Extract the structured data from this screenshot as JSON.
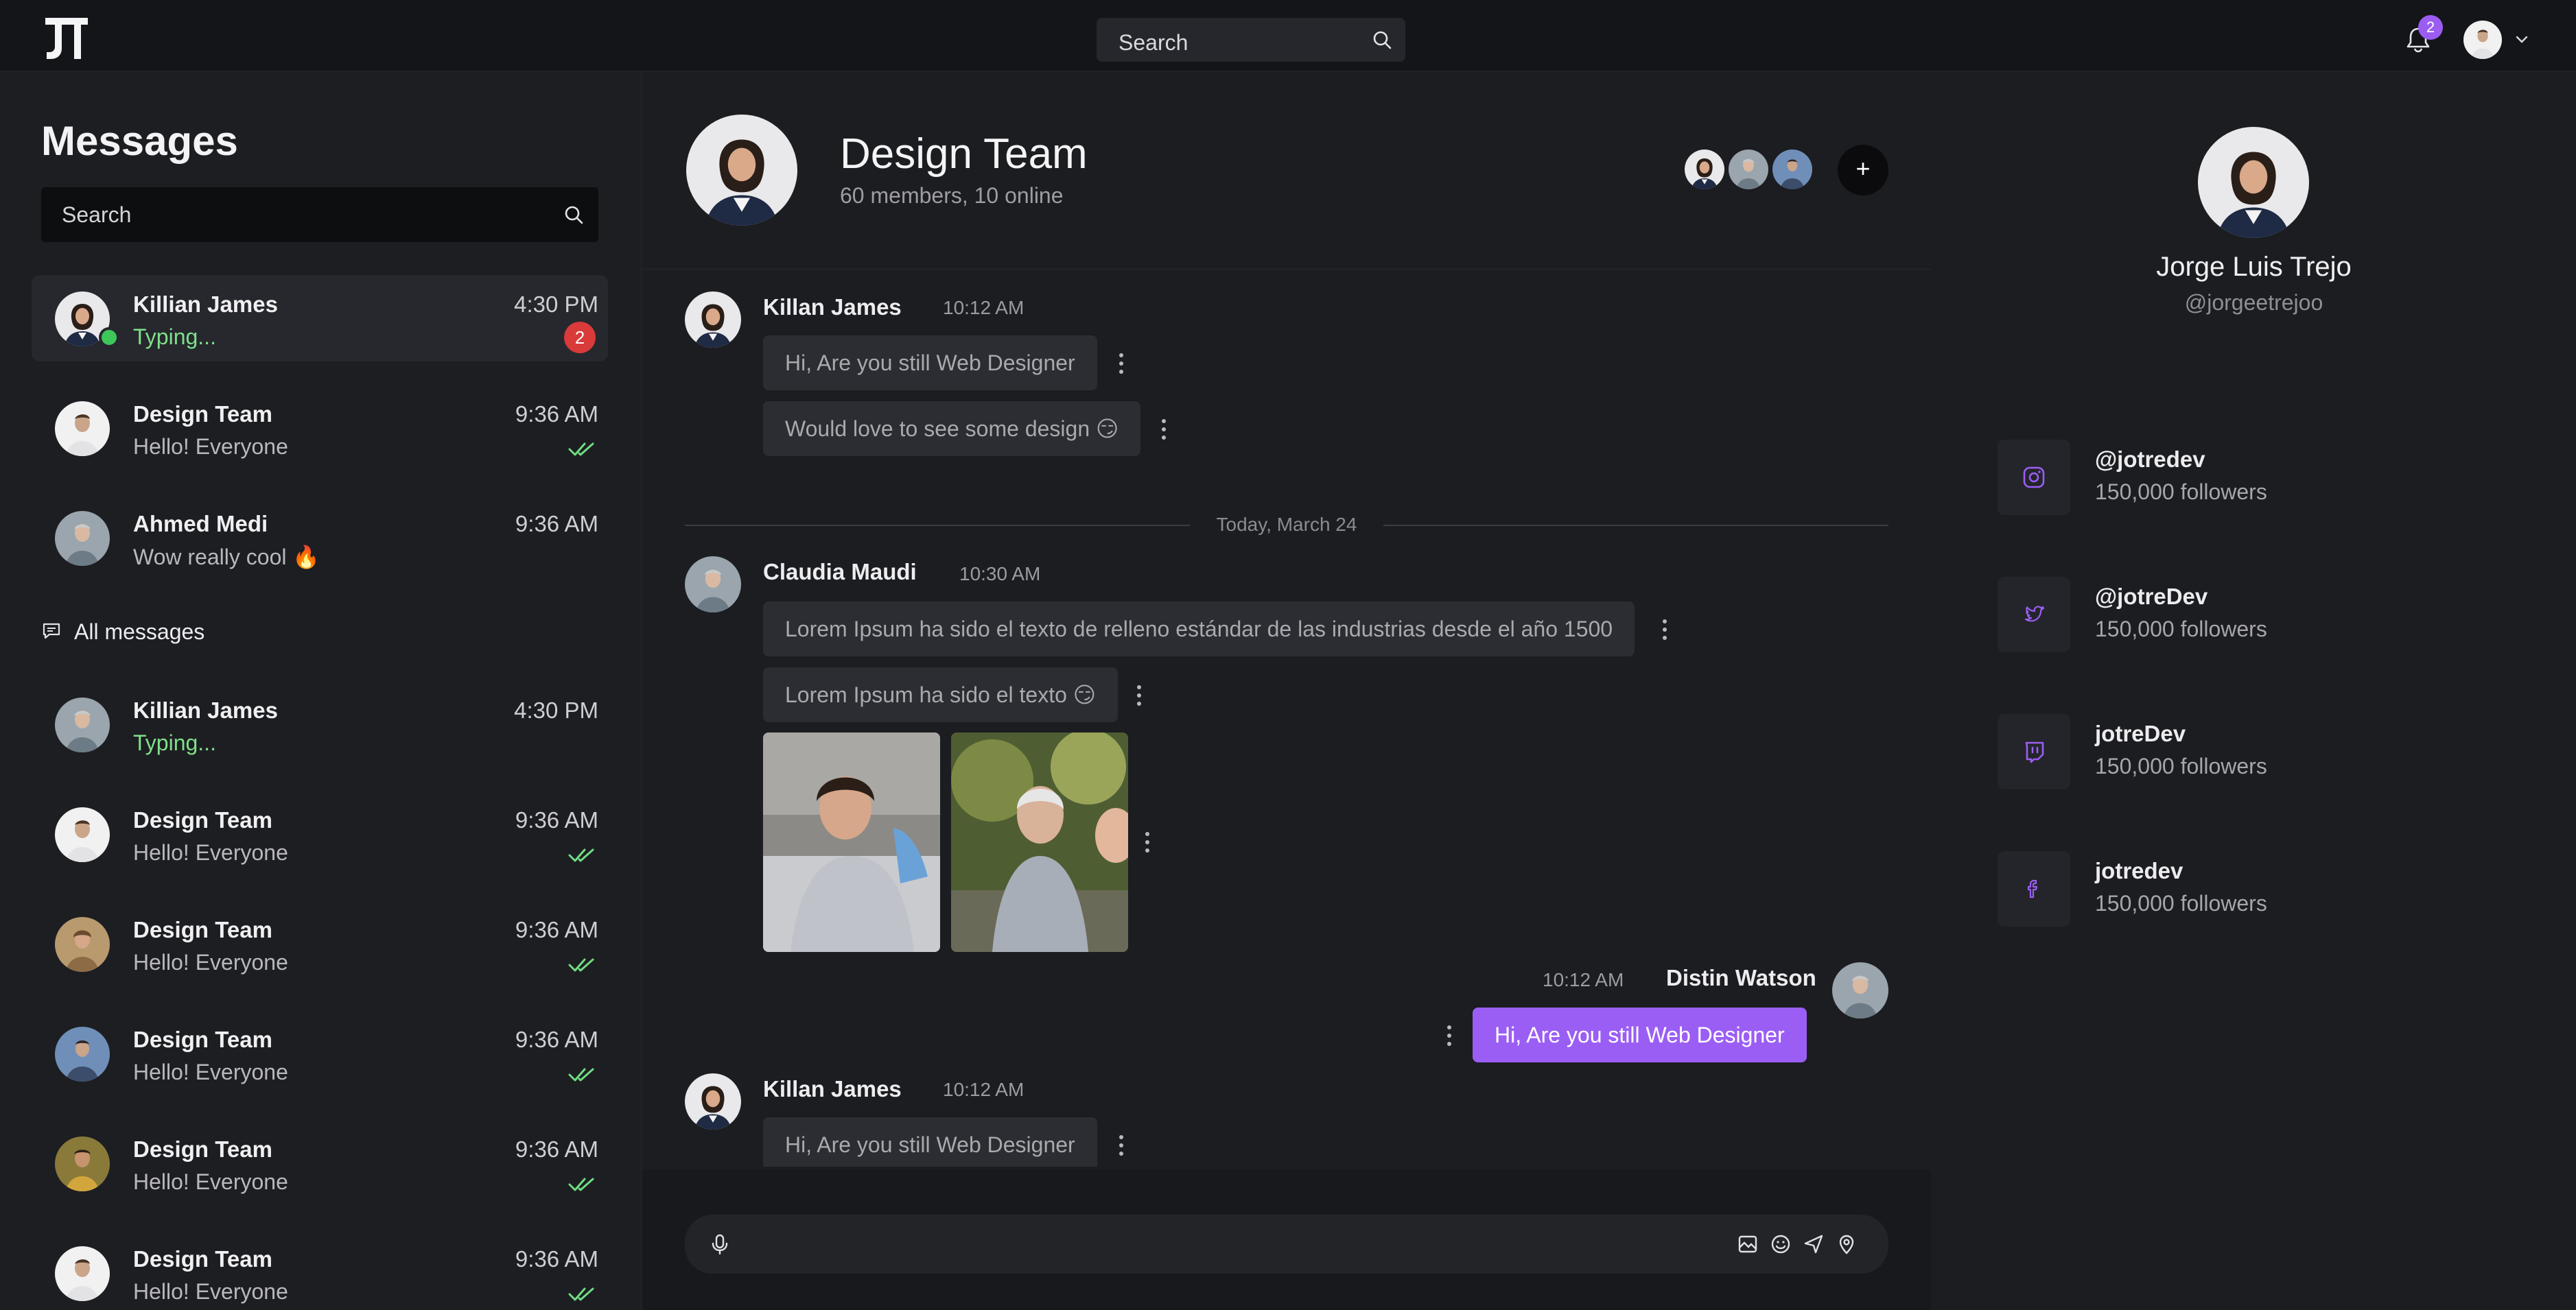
{
  "topbar": {
    "search_placeholder": "Search",
    "notification_count": "2"
  },
  "sidebar": {
    "title": "Messages",
    "search_placeholder": "Search",
    "pinned": [
      {
        "name": "Killian James",
        "message": "Typing...",
        "time": "4:30 PM",
        "unread": "2",
        "typing": true
      },
      {
        "name": "Design Team",
        "message": "Hello! Everyone",
        "time": "9:36 AM",
        "read": true
      },
      {
        "name": "Ahmed Medi",
        "message": "Wow really cool 🔥",
        "time": "9:36 AM"
      }
    ],
    "all_messages_label": "All messages",
    "all": [
      {
        "name": "Killian James",
        "message": "Typing...",
        "time": "4:30 PM",
        "typing": true
      },
      {
        "name": "Design Team",
        "message": "Hello! Everyone",
        "time": "9:36 AM",
        "read": true
      },
      {
        "name": "Design Team",
        "message": "Hello! Everyone",
        "time": "9:36 AM",
        "read": true
      },
      {
        "name": "Design Team",
        "message": "Hello! Everyone",
        "time": "9:36 AM",
        "read": true
      },
      {
        "name": "Design Team",
        "message": "Hello! Everyone",
        "time": "9:36 AM",
        "read": true
      },
      {
        "name": "Design Team",
        "message": "Hello! Everyone",
        "time": "9:36 AM",
        "read": true
      }
    ]
  },
  "chat": {
    "title": "Design Team",
    "subtitle": "60 members, 10 online",
    "add_label": "+",
    "date_divider": "Today, March 24",
    "messages": [
      {
        "author": "Killan James",
        "time": "10:12 AM",
        "bubbles": [
          "Hi, Are you still Web Designer",
          "Would love to see some design 😏"
        ]
      },
      {
        "author": "Claudia Maudi",
        "time": "10:30 AM",
        "bubbles": [
          "Lorem Ipsum ha sido el texto de relleno estándar de las industrias desde el año 1500",
          "Lorem Ipsum ha sido el texto 😏"
        ]
      },
      {
        "author": "Distin Watson",
        "time": "10:12 AM",
        "bubbles": [
          "Hi, Are you still Web Designer"
        ],
        "mine": true
      },
      {
        "author": "Killan James",
        "time": "10:12 AM",
        "bubbles": [
          "Hi, Are you still Web Designer"
        ]
      }
    ]
  },
  "profile": {
    "name": "Jorge Luis Trejo",
    "handle": "@jorgeetrejoo",
    "socials": [
      {
        "icon": "instagram-icon",
        "handle": "@jotredev",
        "followers": "150,000 followers"
      },
      {
        "icon": "twitter-icon",
        "handle": "@jotreDev",
        "followers": "150,000 followers"
      },
      {
        "icon": "twitch-icon",
        "handle": "jotreDev",
        "followers": "150,000 followers"
      },
      {
        "icon": "facebook-icon",
        "handle": "jotredev",
        "followers": "150,000 followers"
      }
    ]
  },
  "colors": {
    "accent": "#9b5ef4",
    "online": "#3ec65a",
    "typing": "#7fe08a",
    "unread_badge": "#d93a3a",
    "panel": "#1c1d21"
  }
}
